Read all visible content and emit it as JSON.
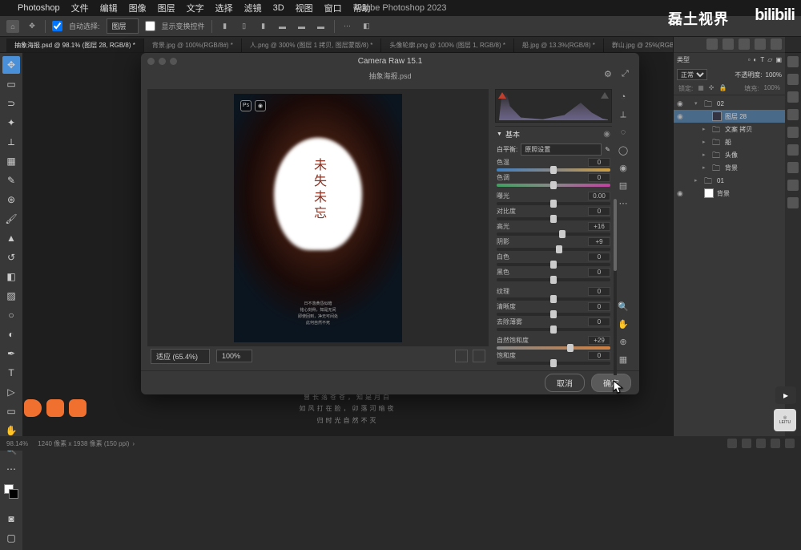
{
  "app": {
    "name": "Photoshop",
    "title": "Adobe Photoshop 2023"
  },
  "menu": [
    "文件",
    "编辑",
    "图像",
    "图层",
    "文字",
    "选择",
    "滤镜",
    "3D",
    "视图",
    "窗口",
    "帮助"
  ],
  "optbar": {
    "auto_select_label": "自动选择:",
    "auto_select_value": "图层",
    "show_transform": "显示变换控件"
  },
  "tabs": [
    {
      "label": "抽象海报.psd @ 98.1% (图层 28, RGB/8) *",
      "active": true
    },
    {
      "label": "背景.jpg @ 100%(RGB/8#) *",
      "active": false
    },
    {
      "label": "人.png @ 300% (图层 1 拷贝, 图层蒙版/8) *",
      "active": false
    },
    {
      "label": "头像轮廓.png @ 100% (图层 1, RGB/8) *",
      "active": false
    },
    {
      "label": "船.jpg @ 13.3%(RGB/8) *",
      "active": false
    },
    {
      "label": "群山.jpg @ 25%(RGB/8#)",
      "active": false
    }
  ],
  "camera_raw": {
    "title": "Camera Raw 15.1",
    "filename": "抽象海报.psd",
    "preview": {
      "zoom_mode": "适应 (65.4%)",
      "zoom_pct": "100%",
      "heading": "未失未忘",
      "lines": [
        "日不落黄昏似暗",
        "铭心刻骨，知是无间",
        "即使回到，净无可间处",
        "此何自然不死"
      ]
    },
    "basic": {
      "section": "基本",
      "wb_label": "白平衡:",
      "wb_value": "原照设置",
      "sliders_a": [
        {
          "name": "色温",
          "value": "0",
          "pos": 50,
          "track": "wb1"
        },
        {
          "name": "色调",
          "value": "0",
          "pos": 50,
          "track": "wb2"
        }
      ],
      "sliders_b": [
        {
          "name": "曝光",
          "value": "0.00",
          "pos": 50
        },
        {
          "name": "对比度",
          "value": "0",
          "pos": 50
        },
        {
          "name": "高光",
          "value": "+16",
          "pos": 58
        },
        {
          "name": "阴影",
          "value": "+9",
          "pos": 55
        },
        {
          "name": "白色",
          "value": "0",
          "pos": 50
        },
        {
          "name": "黑色",
          "value": "0",
          "pos": 50
        }
      ],
      "sliders_c": [
        {
          "name": "纹理",
          "value": "0",
          "pos": 50
        },
        {
          "name": "清晰度",
          "value": "0",
          "pos": 50
        },
        {
          "name": "去除薄雾",
          "value": "0",
          "pos": 50
        }
      ],
      "sliders_d": [
        {
          "name": "自然饱和度",
          "value": "+29",
          "pos": 65,
          "track": "vib"
        },
        {
          "name": "饱和度",
          "value": "0",
          "pos": 50
        }
      ]
    },
    "buttons": {
      "cancel": "取消",
      "ok": "确定"
    }
  },
  "layers_panel": {
    "type_label": "类型",
    "blend": "正常",
    "opacity_label": "不透明度:",
    "opacity": "100%",
    "lock_label": "锁定:",
    "fill_label": "填充:",
    "fill": "100%",
    "items": [
      {
        "type": "group",
        "name": "02",
        "open": true,
        "eye": true,
        "depth": 0
      },
      {
        "type": "layer",
        "name": "图层 28",
        "eye": true,
        "sel": true,
        "depth": 1
      },
      {
        "type": "group",
        "name": "文案 拷贝",
        "eye": false,
        "depth": 1
      },
      {
        "type": "group",
        "name": "船",
        "eye": false,
        "depth": 1
      },
      {
        "type": "group",
        "name": "头像",
        "eye": false,
        "depth": 1
      },
      {
        "type": "group",
        "name": "背景",
        "eye": false,
        "depth": 1
      },
      {
        "type": "group",
        "name": "01",
        "eye": false,
        "depth": 0
      },
      {
        "type": "layer",
        "name": "背景",
        "eye": true,
        "depth": 0,
        "bg": true
      }
    ]
  },
  "bg_lines": [
    "曾长落苍苍，知是月白",
    "如风打在脸，卯落河暗夜",
    "归时光自然不灭"
  ],
  "status": {
    "zoom": "98.14%",
    "dims": "1240 像素 x 1938 像素 (150 ppi)"
  },
  "watermarks": {
    "brand": "磊土视界",
    "bili": "bilibili",
    "leitu": "LEITU"
  }
}
